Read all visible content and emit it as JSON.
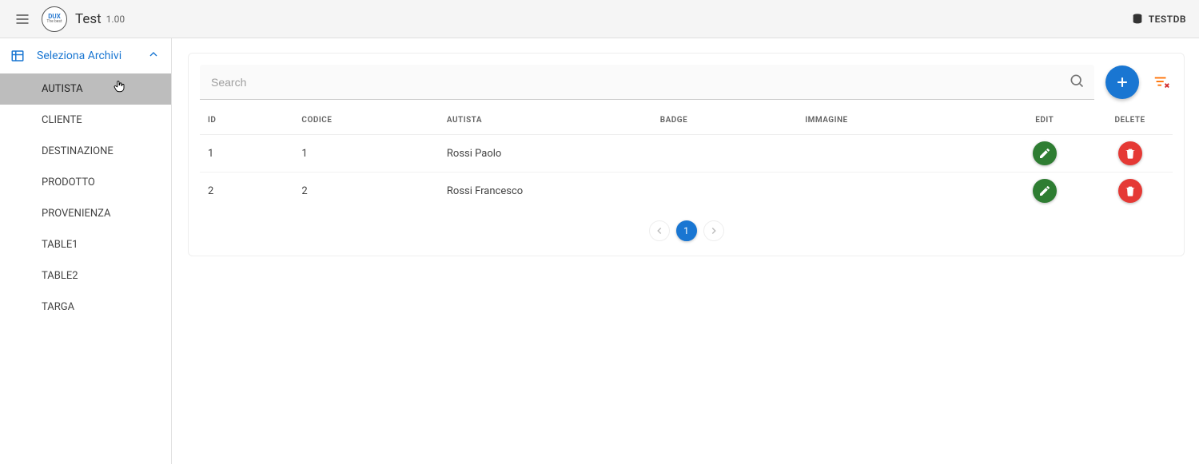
{
  "header": {
    "title": "Test",
    "version": "1.00",
    "db_label": "TESTDB",
    "logo_line1": "DUX",
    "logo_line2": "The best"
  },
  "sidebar": {
    "section_title": "Seleziona Archivi",
    "items": [
      {
        "label": "AUTISTA",
        "active": true
      },
      {
        "label": "CLIENTE",
        "active": false
      },
      {
        "label": "DESTINAZIONE",
        "active": false
      },
      {
        "label": "PRODOTTO",
        "active": false
      },
      {
        "label": "PROVENIENZA",
        "active": false
      },
      {
        "label": "TABLE1",
        "active": false
      },
      {
        "label": "TABLE2",
        "active": false
      },
      {
        "label": "TARGA",
        "active": false
      }
    ]
  },
  "toolbar": {
    "search_placeholder": "Search"
  },
  "table": {
    "columns": {
      "id": "ID",
      "codice": "CODICE",
      "autista": "AUTISTA",
      "badge": "BADGE",
      "immagine": "IMMAGINE",
      "edit": "Edit",
      "delete": "Delete"
    },
    "rows": [
      {
        "id": "1",
        "codice": "1",
        "autista": "Rossi Paolo",
        "badge": "",
        "immagine": ""
      },
      {
        "id": "2",
        "codice": "2",
        "autista": "Rossi Francesco",
        "badge": "",
        "immagine": ""
      }
    ]
  },
  "pagination": {
    "current": "1"
  },
  "colors": {
    "primary": "#1976d2",
    "edit": "#2e7d32",
    "delete": "#e53935",
    "filter": "#ff6f00"
  }
}
